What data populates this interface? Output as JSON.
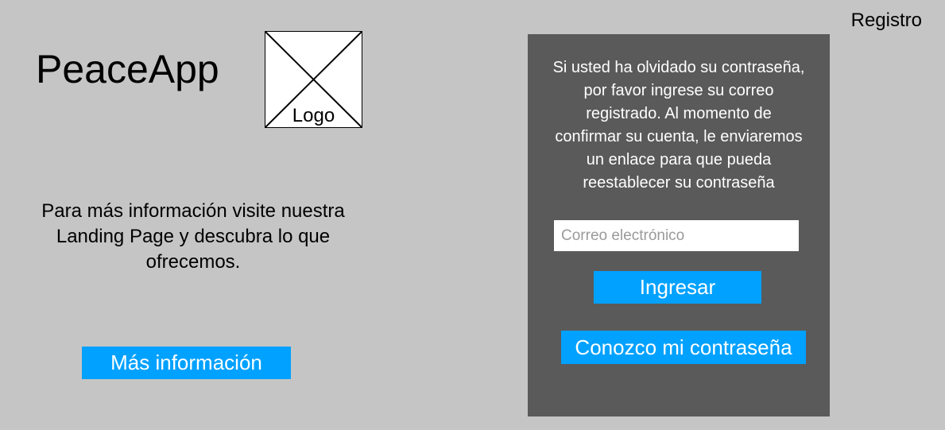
{
  "header": {
    "registro_label": "Registro"
  },
  "brand": {
    "app_name": "PeaceApp",
    "logo_label": "Logo"
  },
  "left": {
    "info_text": "Para más información visite nuestra Landing Page y descubra lo que ofrecemos.",
    "more_info_button": "Más información"
  },
  "panel": {
    "instructions": "Si usted ha olvidado su contraseña, por favor ingrese su correo registrado. Al momento de confirmar su cuenta, le enviaremos un enlace para que pueda reestablecer su contraseña",
    "email_placeholder": "Correo electrónico",
    "email_value": "",
    "submit_button": "Ingresar",
    "know_password_button": "Conozco mi contraseña"
  },
  "colors": {
    "background": "#c5c5c5",
    "panel": "#5a5a5a",
    "accent": "#00a1ff"
  },
  "icons": {
    "logo": "image-placeholder-icon"
  }
}
